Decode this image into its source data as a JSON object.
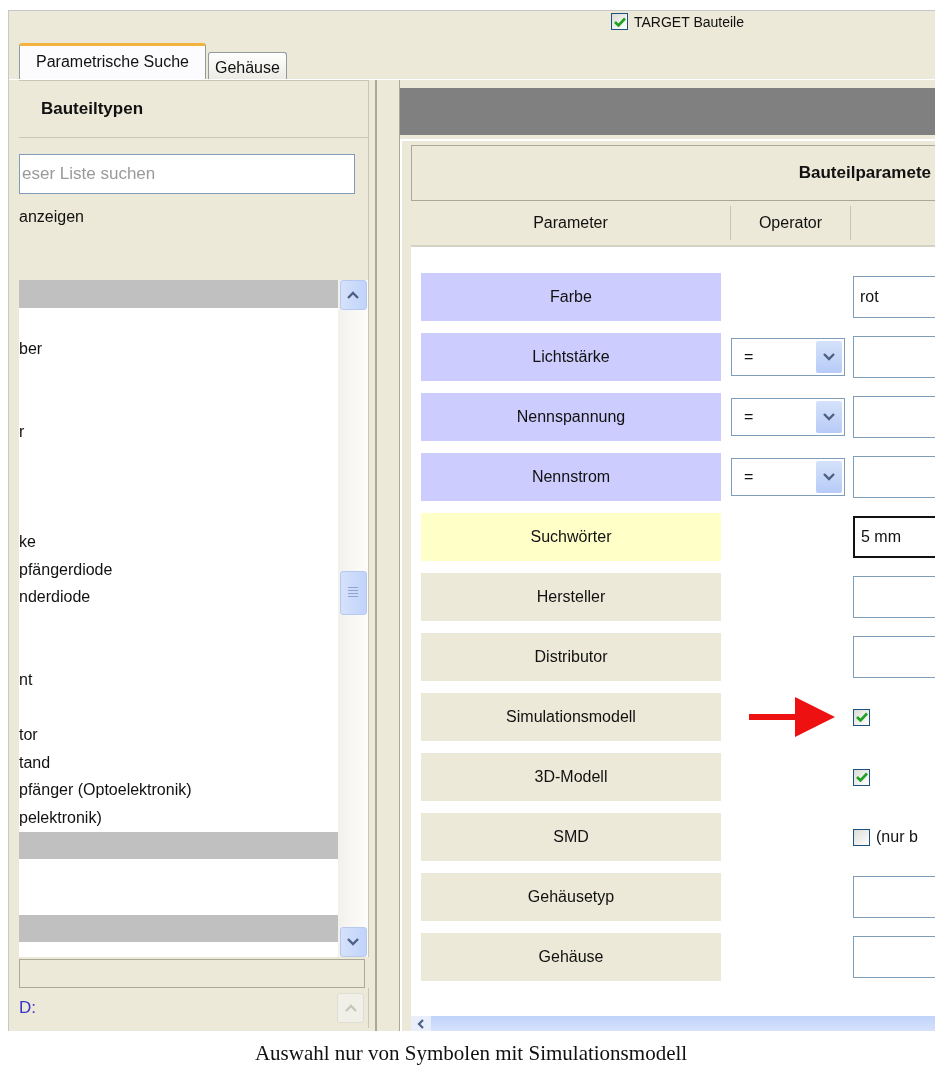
{
  "top_option": {
    "label": "TARGET Bauteile",
    "checked": true
  },
  "tabs": [
    {
      "label": "Parametrische Suche",
      "selected": true
    },
    {
      "label": "Gehäuse",
      "selected": false
    }
  ],
  "type_panel": {
    "title": "Bauteiltypen",
    "search": {
      "placeholder": "eser Liste suchen"
    },
    "show_label": "anzeigen",
    "items": [
      {
        "selected": true
      },
      {
        "selected": false
      },
      {
        "label": "ber",
        "selected": false
      },
      {
        "selected": false
      },
      {
        "selected": false
      },
      {
        "label": "r",
        "selected": false
      },
      {
        "selected": false
      },
      {
        "selected": false
      },
      {
        "selected": false
      },
      {
        "label": "ke",
        "selected": false
      },
      {
        "label": "pfängerdiode",
        "selected": false
      },
      {
        "label": "nderdiode",
        "selected": false
      },
      {
        "selected": false
      },
      {
        "selected": false
      },
      {
        "label": "nt",
        "selected": false
      },
      {
        "selected": false
      },
      {
        "label": "tor",
        "selected": false
      },
      {
        "label": "tand",
        "selected": false
      },
      {
        "label": "pfänger (Optoelektronik)",
        "selected": false
      },
      {
        "label": "pelektronik)",
        "selected": false
      },
      {
        "selected": true
      },
      {
        "selected": false
      },
      {
        "selected": false
      },
      {
        "selected": true
      }
    ],
    "info_label": "D:"
  },
  "param_panel": {
    "title": "Bauteilparamete",
    "columns": [
      "Parameter",
      "Operator"
    ],
    "rows": [
      {
        "name": "Farbe",
        "color": "#ccccff",
        "kind": "field",
        "value": "rot",
        "focused": false,
        "pointer_arrow": false
      },
      {
        "name": "Lichtstärke",
        "color": "#ccccff",
        "kind": "operator_field",
        "operator": "=",
        "focused": false,
        "pointer_arrow": false
      },
      {
        "name": "Nennspannung",
        "color": "#ccccff",
        "kind": "operator_field",
        "operator": "=",
        "focused": false,
        "pointer_arrow": false
      },
      {
        "name": "Nennstrom",
        "color": "#ccccff",
        "kind": "operator_field",
        "operator": "=",
        "focused": false,
        "pointer_arrow": false
      },
      {
        "name": "Suchwörter",
        "color": "#ffffc8",
        "kind": "field",
        "value": "5 mm",
        "focused": true,
        "pointer_arrow": false
      },
      {
        "name": "Hersteller",
        "color": "#ece9d8",
        "kind": "field",
        "focused": false,
        "pointer_arrow": false
      },
      {
        "name": "Distributor",
        "color": "#ece9d8",
        "kind": "field",
        "focused": false,
        "pointer_arrow": false
      },
      {
        "name": "Simulationsmodell",
        "color": "#ece9d8",
        "kind": "checkbox",
        "checked": true,
        "pointer_arrow": true
      },
      {
        "name": "3D-Modell",
        "color": "#ece9d8",
        "kind": "checkbox",
        "checked": true,
        "pointer_arrow": false
      },
      {
        "name": "SMD",
        "color": "#ece9d8",
        "kind": "checkbox",
        "checked": false,
        "note": "(nur b",
        "pointer_arrow": false
      },
      {
        "name": "Gehäusetyp",
        "color": "#ece9d8",
        "kind": "field",
        "focused": false,
        "pointer_arrow": false
      },
      {
        "name": "Gehäuse",
        "color": "#ece9d8",
        "kind": "field",
        "focused": false,
        "pointer_arrow": false
      }
    ]
  },
  "caption": "Auswahl nur von Symbolen mit Simulationsmodell"
}
